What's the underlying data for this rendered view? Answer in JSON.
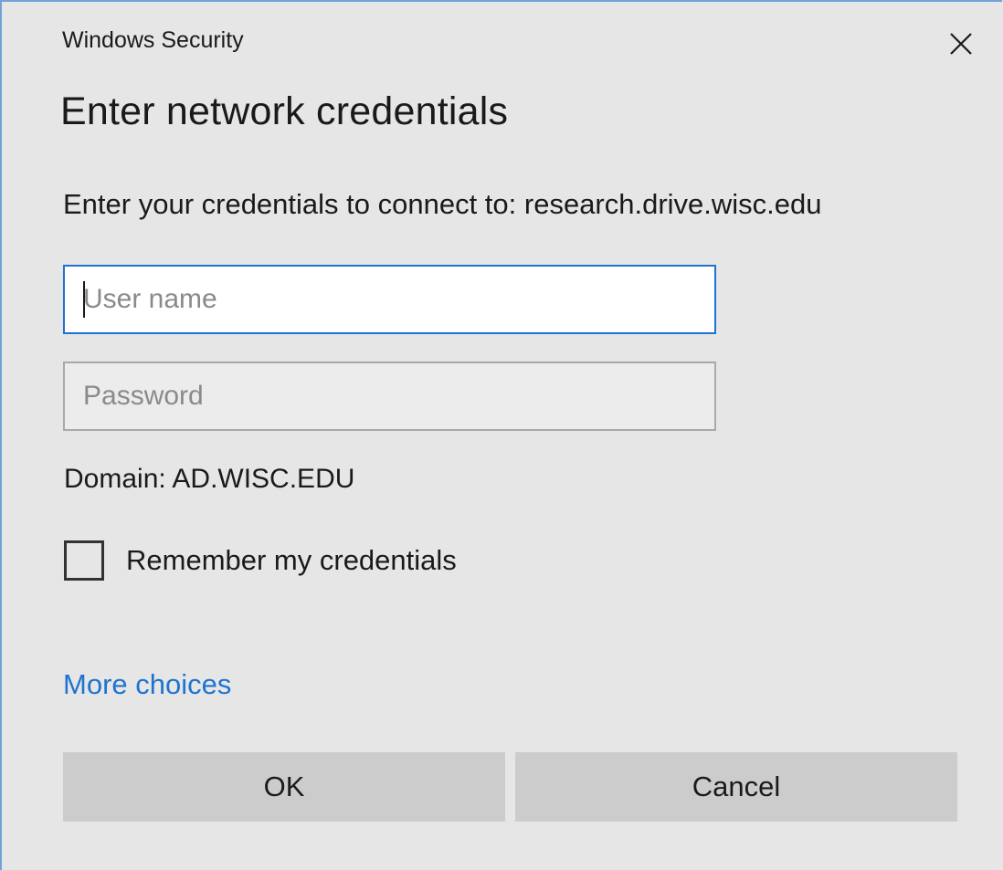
{
  "window": {
    "title": "Windows Security",
    "close_icon": "close-icon"
  },
  "dialog": {
    "heading": "Enter network credentials",
    "prompt": "Enter your credentials to connect to: research.drive.wisc.edu",
    "username": {
      "value": "",
      "placeholder": "User name"
    },
    "password": {
      "value": "",
      "placeholder": "Password"
    },
    "domain": "Domain: AD.WISC.EDU",
    "remember": {
      "label": "Remember my credentials",
      "checked": false
    },
    "more_choices": "More choices",
    "ok_label": "OK",
    "cancel_label": "Cancel"
  },
  "colors": {
    "background": "#e6e6e6",
    "accent": "#1c73d2",
    "link": "#1f74d0",
    "button": "#cccccc",
    "window_border": "#6fa3d8"
  }
}
